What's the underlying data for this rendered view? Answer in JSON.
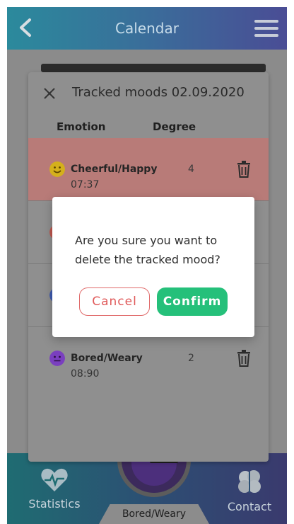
{
  "appbar": {
    "title": "Calendar",
    "back_icon": "chevron-left-icon",
    "menu_icon": "hamburger-menu-icon"
  },
  "panel": {
    "title": "Tracked moods 02.09.2020",
    "close_icon": "close-icon",
    "columns": {
      "emotion": "Emotion",
      "degree": "Degree"
    },
    "moods": [
      {
        "name": "Cheerful/Happy",
        "time": "07:37",
        "degree": "4",
        "face_color": "#d4b01c",
        "selected": true
      },
      {
        "name": "",
        "time": "",
        "degree": "",
        "face_color": "#c0584f",
        "selected": false
      },
      {
        "name": "",
        "time": "",
        "degree": "",
        "face_color": "#3e5bb0",
        "selected": false
      },
      {
        "name": "Bored/Weary",
        "time": "08:90",
        "degree": "2",
        "face_color": "#7a3fbf",
        "selected": false
      }
    ]
  },
  "dialog": {
    "message": "Are you sure you want to delete the tracked mood?",
    "cancel_label": "Cancel",
    "confirm_label": "Confirm"
  },
  "bottomnav": {
    "statistics_label": "Statistics",
    "contact_label": "Contact",
    "current_mood": "Bored/Weary"
  },
  "colors": {
    "accent_confirm": "#25c07a",
    "accent_cancel": "#e05a5a",
    "selected_row": "#b87b78"
  }
}
